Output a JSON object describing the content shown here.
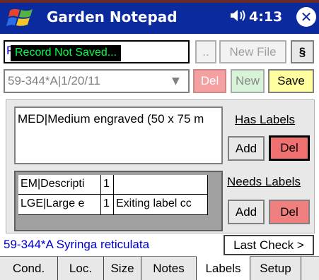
{
  "titlebar": {
    "app_title": "Garden Notepad",
    "volume_icon": "speaker-icon",
    "volume_glyph": "◀ᵋ",
    "clock": "4:13",
    "close_glyph": "✕"
  },
  "file": {
    "path_text": "P\\",
    "status_message": "Record Not Saved...",
    "dots_label": "..",
    "new_file_label": "New File",
    "section_label": "§"
  },
  "record": {
    "selected": "59-344*A|1/20/11",
    "del_label": "Del",
    "new_label": "New",
    "save_label": "Save"
  },
  "has_labels": {
    "heading": "Has Labels",
    "items": [
      "MED|Medium engraved (50 x 75 m"
    ],
    "add_label": "Add",
    "del_label": "Del"
  },
  "needs_labels": {
    "heading": "Needs Labels",
    "rows": [
      [
        "EM|Descripti",
        "1",
        ""
      ],
      [
        "LGE|Large e",
        "1",
        "Exiting label cc"
      ]
    ],
    "add_label": "Add",
    "del_label": "Del"
  },
  "footer": {
    "plant_name": "59-344*A Syringa reticulata",
    "last_check_label": "Last Check >"
  },
  "tabs": [
    "Cond.",
    "Loc.",
    "Size",
    "Notes",
    "Labels",
    "Setup"
  ],
  "active_tab": "Labels",
  "colors": {
    "titlebar": "#0a2a9e",
    "del_button": "#f08080",
    "new_button": "#c8f0c8",
    "save_button": "#ffffa0",
    "status_text": "#00ff44"
  }
}
